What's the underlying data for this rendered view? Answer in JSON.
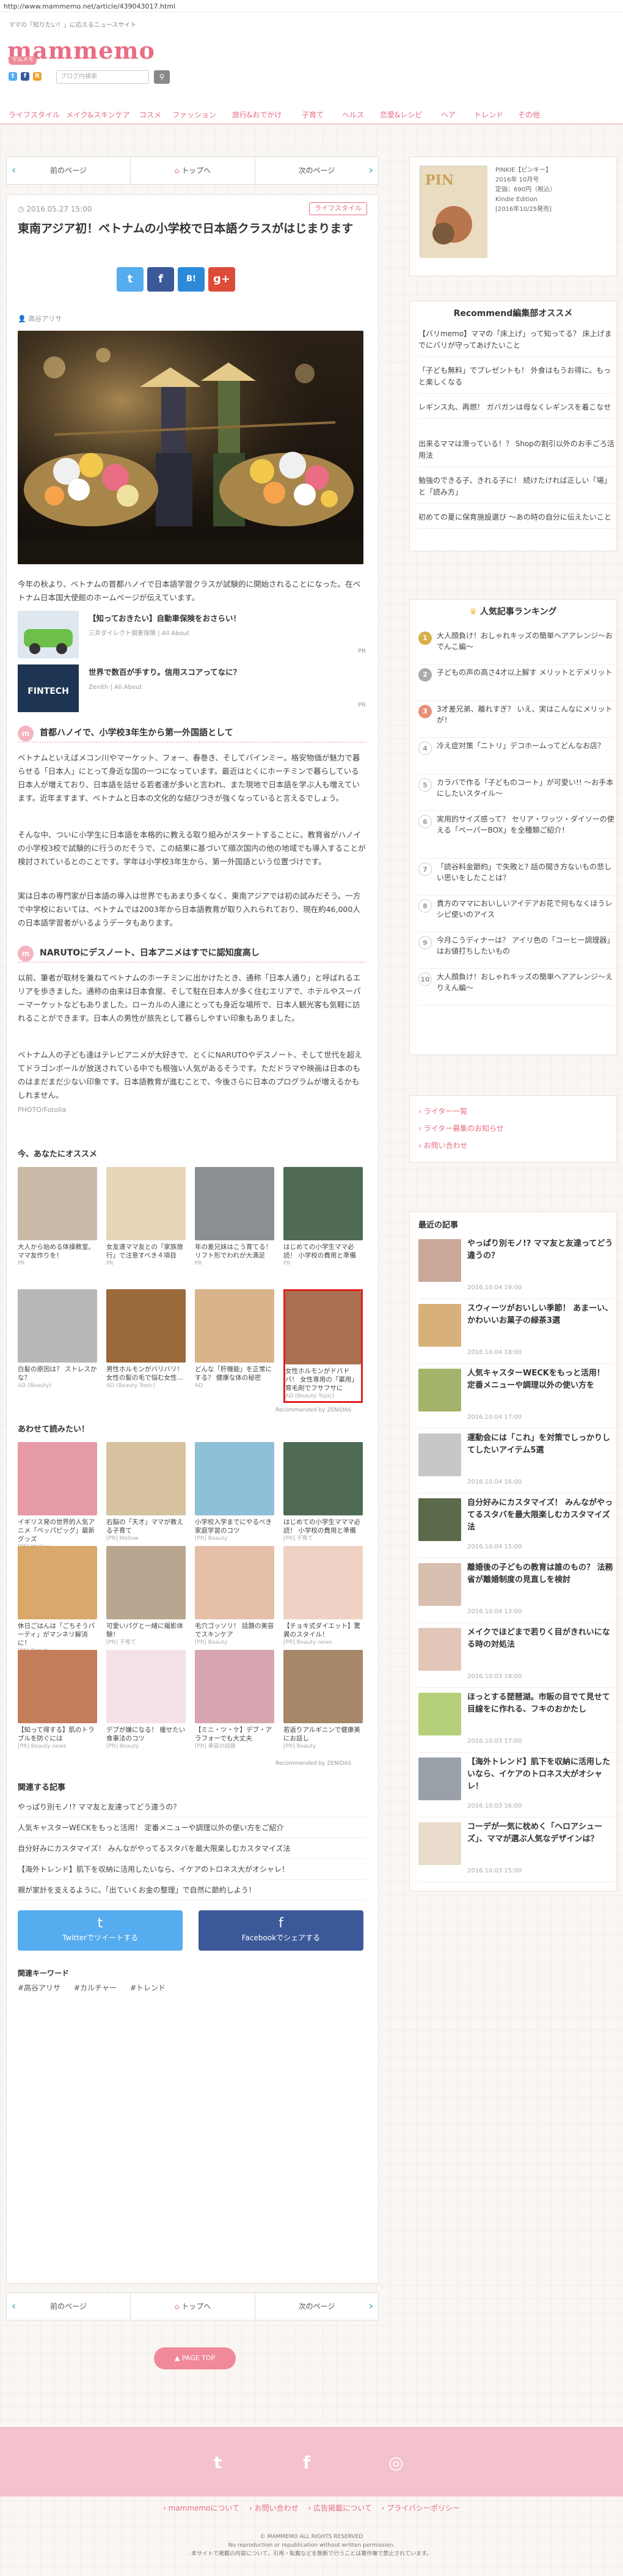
{
  "browser": {
    "url": "http://www.mammemo.net/article/439043017.html"
  },
  "header": {
    "tagline": "ママの「知りたい！」に応えるニュースサイト",
    "logo": "mammemo",
    "logo_badge": "マムメモ",
    "search_placeholder": "ブログ内検索"
  },
  "nav": [
    "ライフスタイル",
    "メイク&スキンケア",
    "コスメ",
    "ファッション",
    "旅行&おでかけ",
    "子育て",
    "ヘルス",
    "恋愛&レシピ",
    "ヘア",
    "トレンド",
    "その他"
  ],
  "pager": {
    "prev": "前のページ",
    "top": "トップへ",
    "next": "次のページ"
  },
  "article": {
    "date": "2016.05.27 15:00",
    "category": "ライフスタイル",
    "title": "東南アジア初！ベトナムの小学校で日本語クラスがはじまります",
    "author": "高谷アリサ",
    "intro": "今年の秋より、ベトナムの首都ハノイで日本語学習クラスが試験的に開始されることになった。在ベトナム日本国大使館のホームページが伝えています。",
    "ads": [
      {
        "title": "【知っておきたい】自動車保険をおさらい！",
        "source": "三井ダイレクト損害保険 | All About",
        "pr": "PR"
      },
      {
        "title": "世界で数百が手すり。信用スコアってなに？",
        "source": "Zenith | All About",
        "pr": "PR"
      }
    ],
    "section1_title": "首都ハノイで、小学校3年生から第一外国語として",
    "section1_text_a": "ベトナムといえばメコン川やマーケット、フォー、春巻き、そしてバインミー。格安物価が魅力で暮らせる「日本人」にとって身近な国の一つになっています。最近はとくにホーチミンで暮らしている日本人が増えており、日本語を話せる若者達が多いと言われ、また現地で日本語を学ぶ人も増えています。近年ますます、ベトナムと日本の文化的な結びつきが強くなっていると言えるでしょう。",
    "section1_text_b": "そんな中、ついに小学生に日本語を本格的に教える取り組みがスタートすることに。教育省がハノイの小学校3校で試験的に行うのだそうで、この結果に基づいて順次国内の他の地域でも導入することが検討されているとのことです。学年は小学校3年生から、第一外国語という位置づけです。",
    "section1_text_c": "実は日本の専門家が日本語の導入は世界でもあまり多くなく、東南アジアでは初の試みだそう。一方で中学校においては、ベトナムでは2003年から日本語教育が取り入れられており、現在約46,000人の日本語学習者がいるようデータもあります。",
    "section2_title": "NARUTOにデスノート、日本アニメはすでに認知度高し",
    "section2_text_a": "以前、筆者が取材を兼ねてベトナムのホーチミンに出かけたとき、通称「日本人通り」と呼ばれるエリアを歩きました。通称の由来は日本食屋、そして駐在日本人が多く住むエリアで、ホテルやスーパーマーケットなどもありました。ローカルの人達にとっても身近な場所で、日本人観光客も気軽に訪れることができます。日本人の男性が旅先として暮らしやすい印象もありました。",
    "section2_text_b": "ベトナム人の子ども達はテレビアニメが大好きで、とくにNARUTOやデスノート、そして世代を超えてドラゴンボールが放送されている中でも根強い人気があるそうです。ただドラマや映画は日本のものはまだまだ少ない印象です。日本語教育が進むことで、今後さらに日本のプログラムが増えるかもしれません。",
    "photo_credit": "PHOTO/Fotolia"
  },
  "recommend": {
    "heading": "今、あなたにオススメ",
    "items": [
      {
        "cap": "大人から始める体操教室。ママ友作りを！",
        "src": "PR"
      },
      {
        "cap": "女友達ママ友との「家族旅行」で注意すべき４項目",
        "src": "PR"
      },
      {
        "cap": "年の差兄妹はこう育てる！ リフト形でわれが大満足",
        "src": "PR"
      },
      {
        "cap": "はじめての小学生ママ必読！ 小学校の費用と準備",
        "src": "PR"
      },
      {
        "cap": "白髪の原因は？ ストレスかな？",
        "src": "AD (Beauty)"
      },
      {
        "cap": "男性ホルモンがバリバリ！ 女性の髪の毛で悩む女性…",
        "src": "AD (Beauty Topic)"
      },
      {
        "cap": "どんな「肝機能」を正常にする？ 健康な体の秘密",
        "src": "AD"
      },
      {
        "cap": "女性ホルモンがドバドバ！ 女性専用の「薬用」育毛剤でフサフサに",
        "src": "AD (Beauty Topic)"
      }
    ],
    "powered": "Recommended by ZENIDAS",
    "read_heading": "あわせて読みたい！",
    "read_items": [
      {
        "cap": "イギリス発の世界的人気アニメ「ペッパピッグ」最新グッズ",
        "src": "[PR] Mellow"
      },
      {
        "cap": "右脳の「天才」ママが教える子育て",
        "src": "[PR] Mellow"
      },
      {
        "cap": "小学校入学までにやるべき家庭学習のコツ",
        "src": "[PR] Beauty"
      },
      {
        "cap": "はじめての小学生マママ必読！ 小学校の費用と準備",
        "src": "[PR] 子育て"
      },
      {
        "cap": "休日ごはんは「ごちそうパーティ」がマンネリ解消に！",
        "src": "[PR] Beauty"
      },
      {
        "cap": "可愛いパグと一緒に撮影体験！",
        "src": "[PR] 子育て"
      },
      {
        "cap": "毛穴ゴッソリ！ 話題の美容でスキンケア",
        "src": "[PR] Beauty"
      },
      {
        "cap": "【チョキ式ダイエット】驚異のスタイル！",
        "src": "[PR] Beauty news"
      },
      {
        "cap": "【知って得する】肌のトラブルを防ぐには",
        "src": "[PR] Beauty news"
      },
      {
        "cap": "デブが嫌になる！ 痩せたい食事法のコツ",
        "src": "[PR] Beauty"
      },
      {
        "cap": "【ミニ・ツ・ケ】デブ・アラフォーでも大丈夫",
        "src": "[PR] 美容の話題"
      },
      {
        "cap": "若返りアルギニンで健康美にお話し",
        "src": "[PR] Beauty"
      }
    ],
    "read_powered": "Recommended by ZENIDAS"
  },
  "related": {
    "heading": "関連する記事",
    "items": [
      "やっぱり別モノ!? ママ友と友達ってどう違うの？",
      "人気キャスターWECKをもっと活用！ 定番メニューや調理以外の使い方をご紹介",
      "自分好みにカスタマイズ！ みんながやってるスタバを最大限楽しむカスタマイズ法",
      "【海外トレンド】肌下を収納に活用したいなら、イケアのトロネス大がオシャレ！",
      "親が家計を支えるように。「出ていくお金の整理」で自然に節約しよう！"
    ]
  },
  "share_buttons": {
    "twitter": "Twitterでツイートする",
    "facebook": "Facebookでシェアする"
  },
  "keywords": {
    "heading": "関連キーワード",
    "tags": [
      "#高谷アリサ",
      "#カルチャー",
      "#トレンド"
    ]
  },
  "sidebar": {
    "magazine": [
      "PINKIE【ピンキー】",
      "2016年 10月号",
      "定価：690円（税込）",
      "Kindle Edition",
      "[2016年10/25発売]"
    ],
    "editor_heading": "Recommend編集部オススメ",
    "editor_items": [
      "【バリmemo】ママの「床上げ」って知ってる？ 床上げまでにバリが守ってあげたいこと",
      "「子ども無料」でプレゼントも！ 外食はもうお得に、もっと楽しくなる",
      "レギンス丸、再燃！ ガバガンは母なくレギンスを着こなせ",
      "出来るママは滑っている！？ Shopの割引以外のお手ごろ活用法",
      "勉強のできる子、きれる子に！ 続けたければ正しい「場」と「読み方」",
      "初めての夏に保育施設選び ～あの時の自分に伝えたいこと"
    ],
    "ranking_heading": "人気記事ランキング",
    "ranking": [
      "大人顔負け！おしゃれキッズの簡単ヘアアレンジ～おでんこ編～",
      "子どもの声の高さ4才以上解す メリットとデメリット",
      "3才差兄弟、離れすぎ？ いえ、実はこんなにメリットが！",
      "冷え症対策「ニトリ」デコホームってどんなお店？",
      "カラバで作る「子どものコート」が可愛い!! ～お手本にしたいスタイル～",
      "実用的サイズ感って？ セリア・ワッツ・ダイソーの使える「ペーパーBOX」を全種類ご紹介！",
      "「読谷料金節約」で失敗と? 話の聞き方ないもの悲しい思いをしたことは？",
      "貴方のママにおいしいアイデアお花で何もなくほうレシピ使いのアイス",
      "今月こうディナーは？ アイリ色の「コーヒー調理器」はお値打ちしたいもの",
      "大人顔負け！おしゃれキッズの簡単ヘアアレンジ～えりえん編～"
    ],
    "links": [
      "ライター一覧",
      "ライター募集のお知らせ",
      "お問い合わせ"
    ],
    "latest_heading": "最近の記事",
    "latest": [
      {
        "title": "やっぱり別モノ!? ママ友と友達ってどう違うの？",
        "date": "2016.10.04 19:00"
      },
      {
        "title": "スウィーツがおいしい季節！ あまーい、かわいいお菓子の緑茶3選",
        "date": "2016.10.04 18:00"
      },
      {
        "title": "人気キャスターWECKをもっと活用！ 定番メニューや調理以外の使い方を",
        "date": "2016.10.04 17:00"
      },
      {
        "title": "運動会には「これ」を対策でしっかりしてしたいアイテム5選",
        "date": "2016.10.04 16:00"
      },
      {
        "title": "自分好みにカスタマイズ！ みんながやってるスタバを最大限楽しむカスタマイズ法",
        "date": "2016.10.04 15:00"
      },
      {
        "title": "離婚後の子どもの教育は誰のもの？ 法務省が離婚制度の見直しを検討",
        "date": "2016.10.04 13:00"
      },
      {
        "title": "メイクでほどまで若りく目がきれいになる時の対処法",
        "date": "2016.10.03 18:00"
      },
      {
        "title": "ほっとする琵琶湖。市販の目でて見せて目線をに作れる、フキのおかたし",
        "date": "2016.10.03 17:00"
      },
      {
        "title": "【海外トレンド】肌下を収納に活用したいなら、イケアのトロネス大がオシャレ！",
        "date": "2016.10.03 16:00"
      },
      {
        "title": "コーデが一気に枕めく「ヘロアシューズ」、ママが選ぶ人気なデザインは？",
        "date": "2016.10.03 15:00"
      }
    ]
  },
  "footer": {
    "page_top": "PAGE TOP",
    "links": [
      "mammemoについて",
      "お問い合わせ",
      "広告掲載について",
      "プライバシーポリシー"
    ],
    "copyright": "© MAMMEMO ALL RIGHTS RESERVED",
    "copyright2": "No reproduction or republication without written permission.",
    "copyright3": "本サイトで掲載の内容について、引用・転載などを無断で行うことは著作権で禁止されています。"
  }
}
